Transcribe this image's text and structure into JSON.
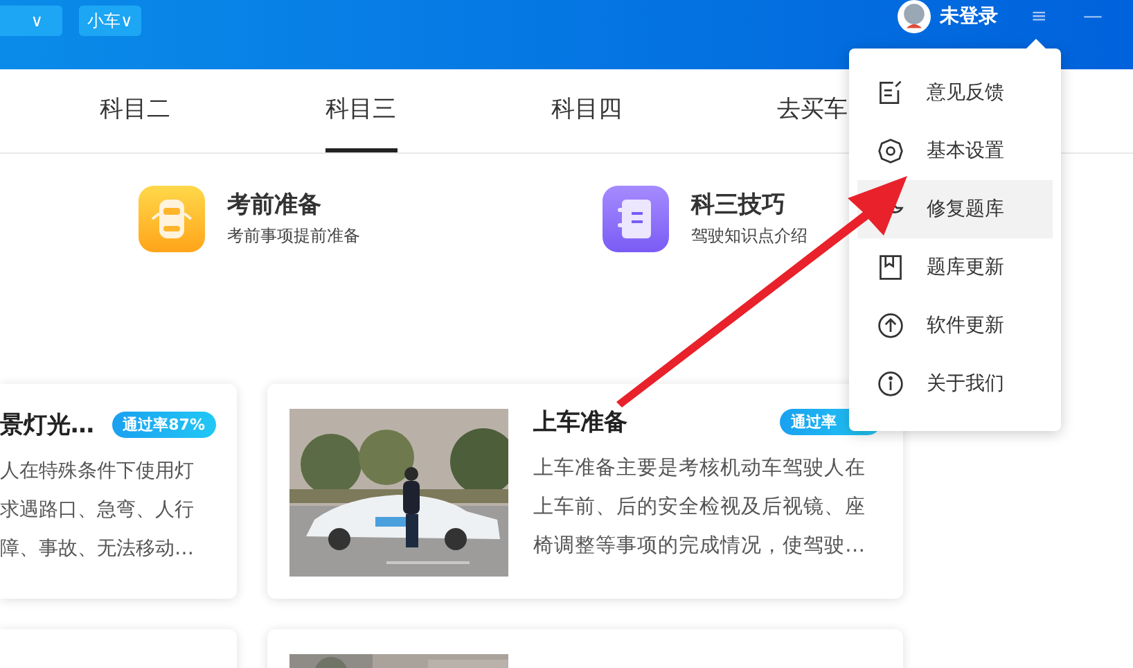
{
  "header": {
    "dropdown_chevron": "∨",
    "vehicle_button": "小车∨",
    "user_label": "未登录",
    "menu_glyph": "≡",
    "minimize_glyph": "—"
  },
  "tabs": [
    {
      "label": "科目二",
      "selected": false
    },
    {
      "label": "科目三",
      "selected": true
    },
    {
      "label": "科目四",
      "selected": false
    },
    {
      "label": "去买车",
      "selected": false
    }
  ],
  "features": [
    {
      "kind": "car",
      "title": "考前准备",
      "subtitle": "考前事项提前准备"
    },
    {
      "kind": "notebook",
      "title": "科三技巧",
      "subtitle": "驾驶知识点介绍"
    }
  ],
  "cards": [
    {
      "title": "景灯光…",
      "badge": "通过率87%",
      "description_lines": [
        "人在特殊条件下使用灯",
        "求遇路口、急弯、人行",
        "障、事故、无法移动…"
      ]
    },
    {
      "title": "上车准备",
      "badge": "通过率",
      "description": "上车准备主要是考核机动车驾驶人在上车前、后的安全检视及后视镜、座椅调整等事项的完成情况，使驾驶…"
    }
  ],
  "menu": {
    "items": [
      {
        "label": "意见反馈",
        "highlighted": false
      },
      {
        "label": "基本设置",
        "highlighted": false
      },
      {
        "label": "修复题库",
        "highlighted": true
      },
      {
        "label": "题库更新",
        "highlighted": false
      },
      {
        "label": "软件更新",
        "highlighted": false
      },
      {
        "label": "关于我们",
        "highlighted": false
      }
    ]
  },
  "annotation": {
    "kind": "arrow"
  }
}
